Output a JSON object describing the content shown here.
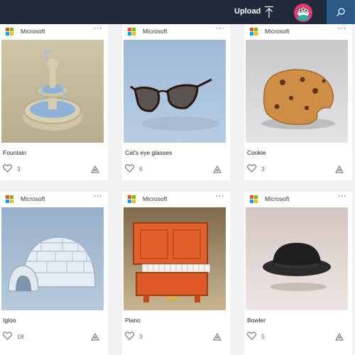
{
  "header": {
    "upload_label": "Upload"
  },
  "cards": [
    {
      "publisher": "Microsoft",
      "more": "···",
      "title": "Fountain",
      "likes": "3"
    },
    {
      "publisher": "Microsoft",
      "more": "···",
      "title": "Cat's eye glasses",
      "likes": "6"
    },
    {
      "publisher": "Microsoft",
      "more": "···",
      "title": "Cookie",
      "likes": "3"
    },
    {
      "publisher": "Microsoft",
      "more": "···",
      "title": "Igloo",
      "likes": "18"
    },
    {
      "publisher": "Microsoft",
      "more": "···",
      "title": "Piano",
      "likes": "3"
    },
    {
      "publisher": "Microsoft",
      "more": "···",
      "title": "Bowler",
      "likes": "5"
    }
  ],
  "colors": {
    "topbar": "#202a3b",
    "search_button": "#2c5a88",
    "ms_red": "#f25022",
    "ms_green": "#7fba00",
    "ms_blue": "#00a4ef",
    "ms_yellow": "#ffb900"
  },
  "icons": [
    "upload-icon",
    "avatar",
    "search-icon",
    "microsoft-logo",
    "more-options-icon",
    "heart-icon",
    "view-in-3d-icon"
  ]
}
